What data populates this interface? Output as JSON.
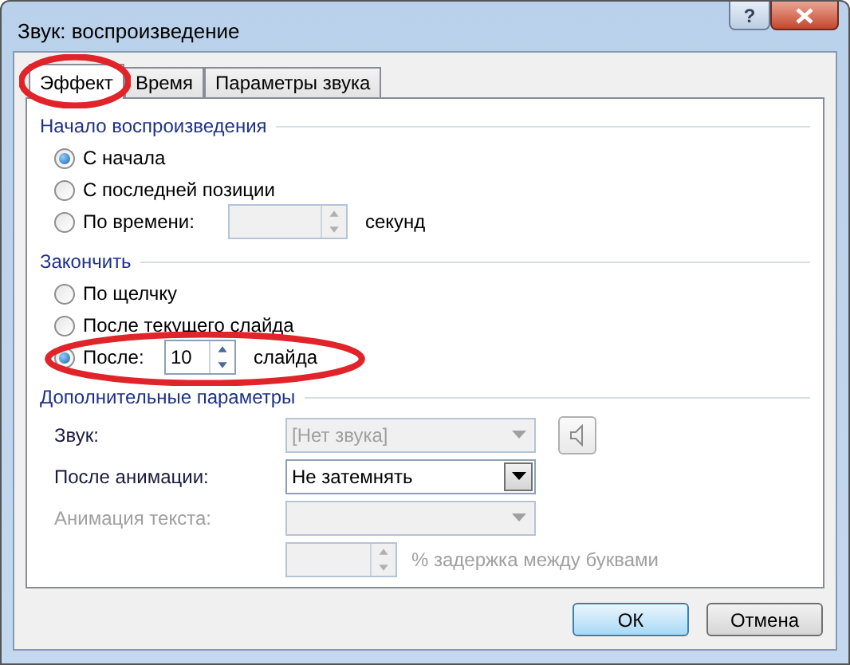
{
  "window": {
    "title": "Звук: воспроизведение",
    "help": "?"
  },
  "tabs": [
    {
      "label": "Эффект",
      "selected": true,
      "highlighted": true
    },
    {
      "label": "Время",
      "selected": false,
      "highlighted": false
    },
    {
      "label": "Параметры звука",
      "selected": false,
      "highlighted": false
    }
  ],
  "start": {
    "title": "Начало воспроизведения",
    "options": [
      {
        "kind": "plain",
        "label": "С начала",
        "selected": true,
        "highlighted": false
      },
      {
        "kind": "plain",
        "label": "С последней позиции",
        "selected": false,
        "highlighted": false
      },
      {
        "kind": "spin",
        "label": "По времени:",
        "selected": false,
        "highlighted": false,
        "disabled": true,
        "unit": "секунд"
      }
    ]
  },
  "stop": {
    "title": "Закончить",
    "options": [
      {
        "kind": "plain",
        "label": "По щелчку",
        "selected": false,
        "highlighted": false
      },
      {
        "kind": "plain",
        "label": "После текущего слайда",
        "selected": false,
        "highlighted": false
      },
      {
        "kind": "spin",
        "label": "После:",
        "selected": true,
        "highlighted": true,
        "disabled": false,
        "value": "10",
        "unit": "слайда"
      }
    ]
  },
  "extra": {
    "title": "Дополнительные параметры",
    "rows": [
      {
        "kind": "combo",
        "label": "Звук:",
        "value": "[Нет звука]",
        "disabled": true,
        "label_disabled": false,
        "speaker": true
      },
      {
        "kind": "combo",
        "label": "После анимации:",
        "value": "Не затемнять",
        "disabled": false,
        "label_disabled": false
      },
      {
        "kind": "combo",
        "label": "Анимация текста:",
        "disabled": true,
        "label_disabled": true
      },
      {
        "kind": "spin",
        "label": "% задержка между буквами",
        "disabled": true
      }
    ]
  },
  "buttons": [
    {
      "label": "ОК",
      "default": true
    },
    {
      "label": "Отмена",
      "default": false
    }
  ]
}
